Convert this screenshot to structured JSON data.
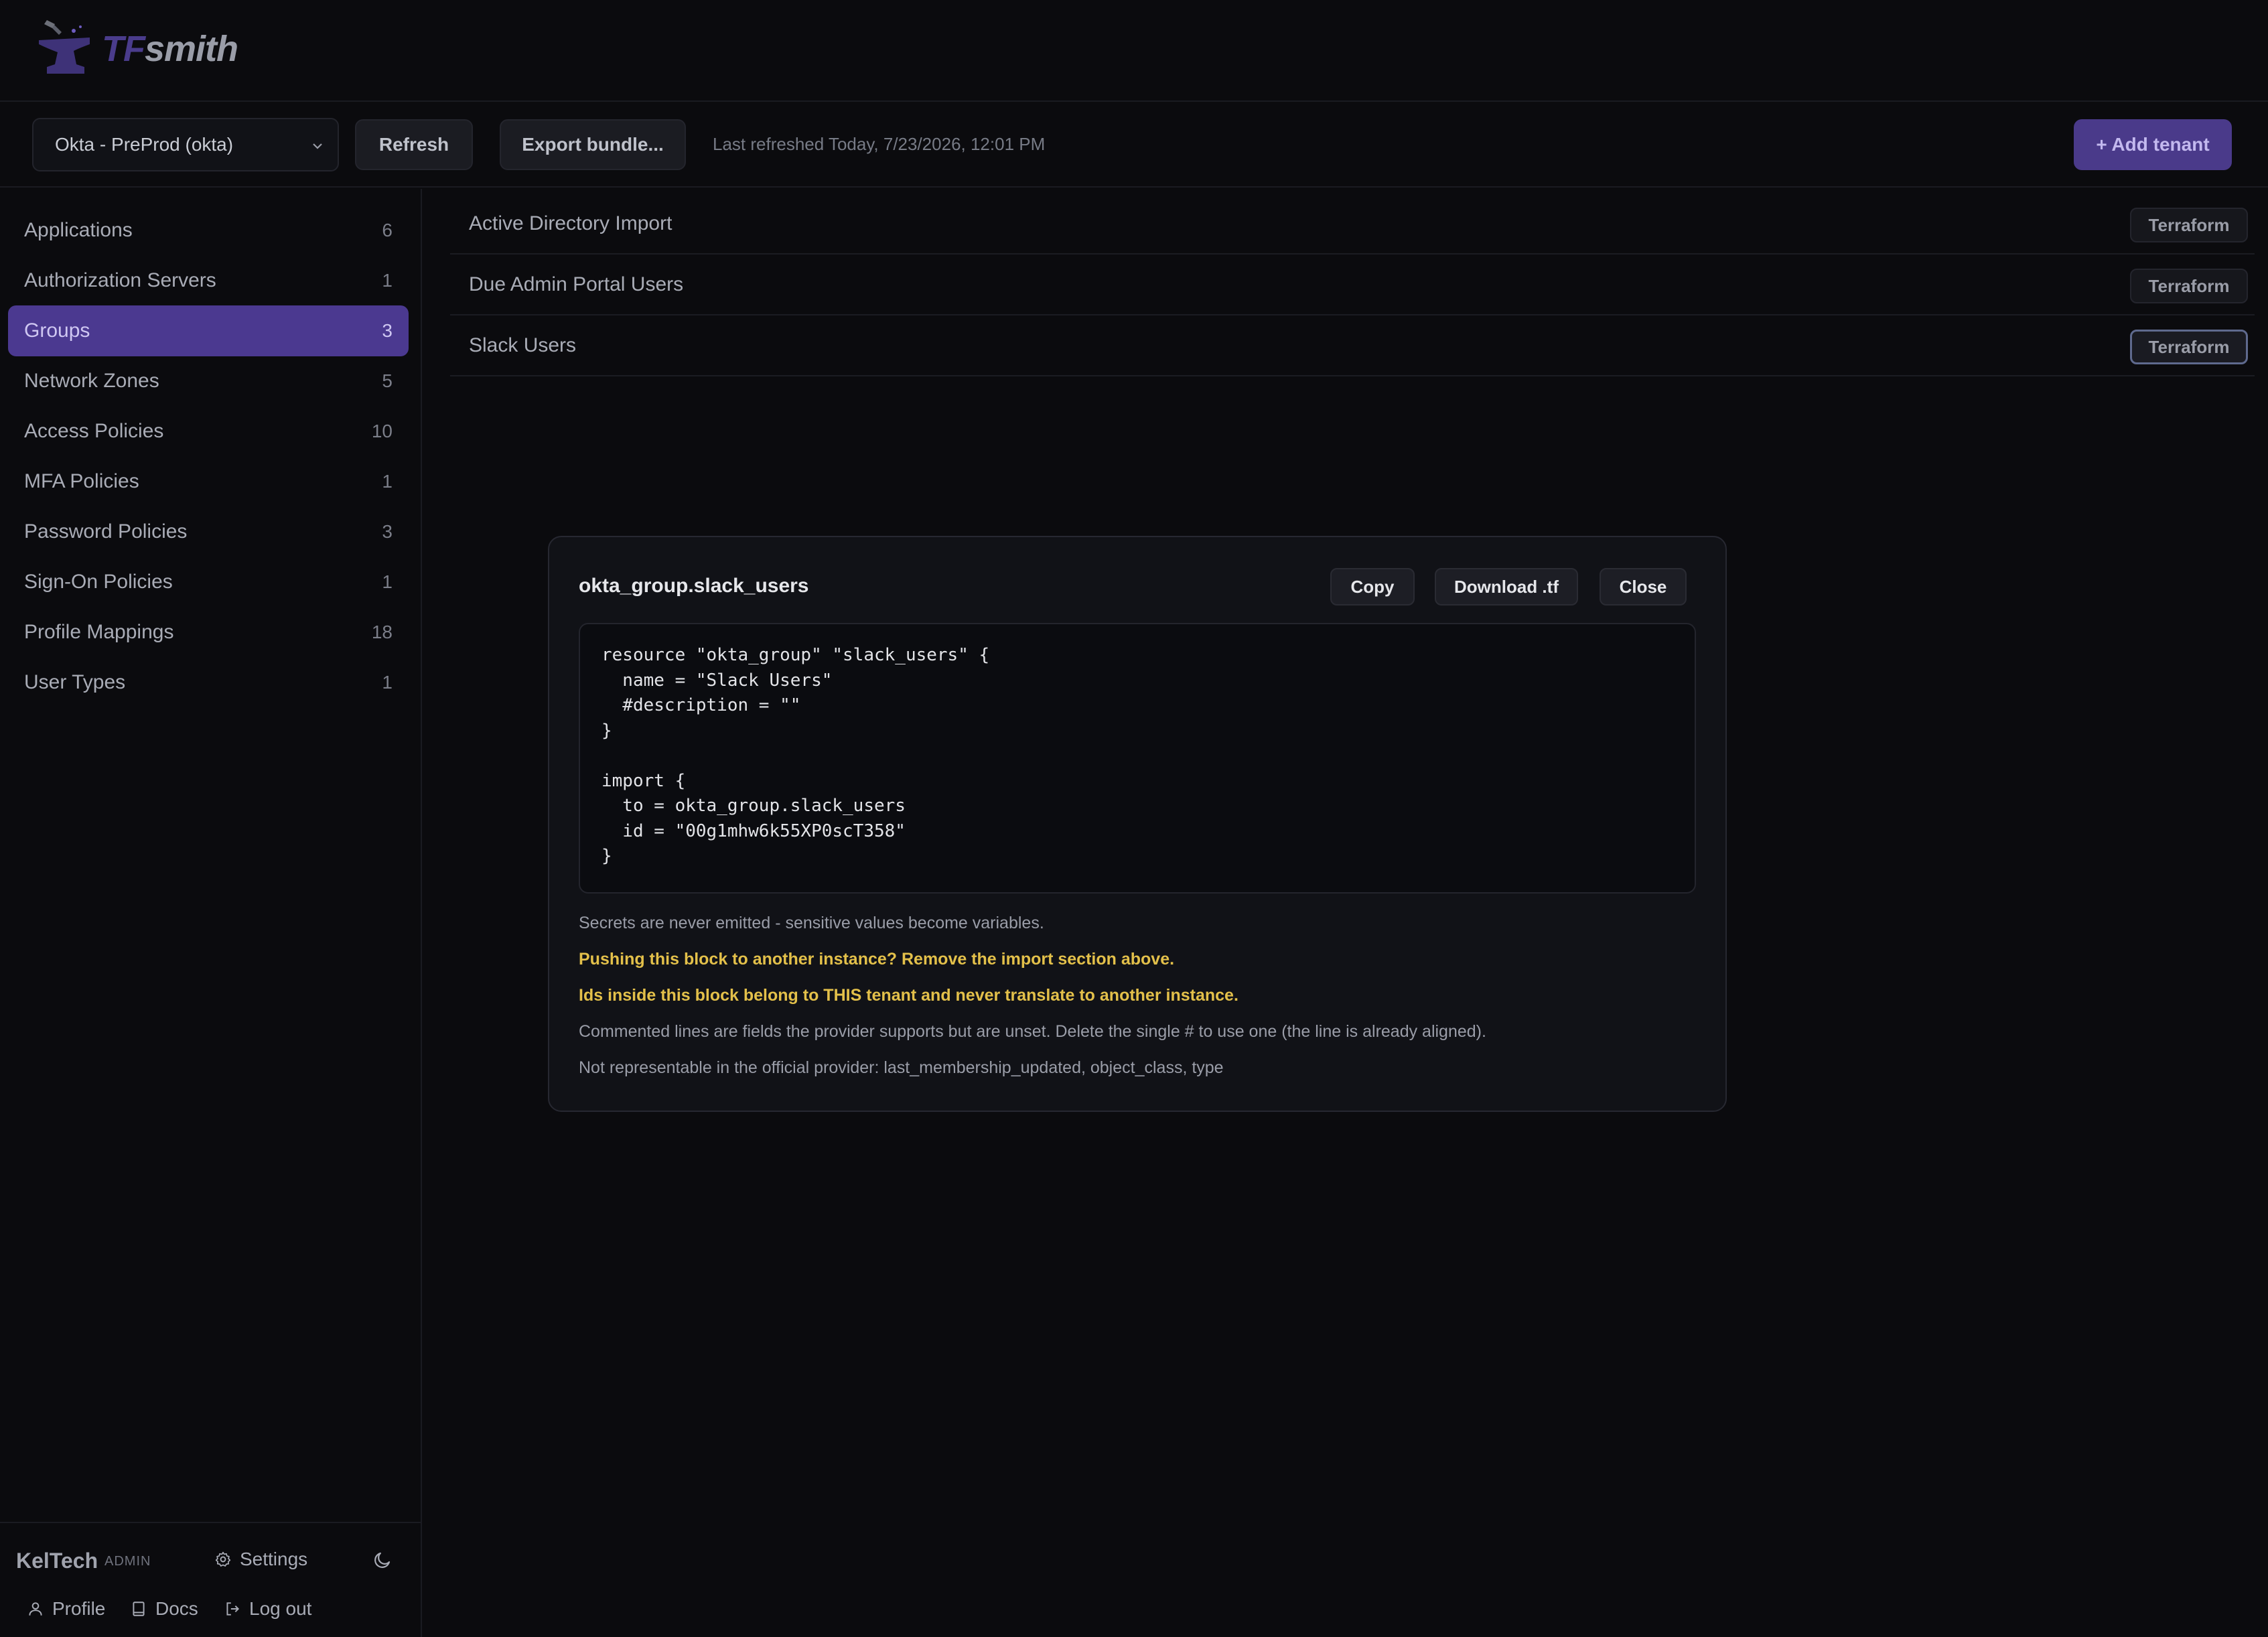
{
  "app": {
    "logo_tf": "TF",
    "logo_smith": "smith"
  },
  "toolbar": {
    "tenant_selected": "Okta - PreProd (okta)",
    "refresh_label": "Refresh",
    "export_label": "Export bundle...",
    "last_refreshed": "Last refreshed Today, 7/23/2026, 12:01 PM",
    "add_tenant_label": "+ Add tenant"
  },
  "sidebar": {
    "items": [
      {
        "label": "Applications",
        "count": "6"
      },
      {
        "label": "Authorization Servers",
        "count": "1"
      },
      {
        "label": "Groups",
        "count": "3"
      },
      {
        "label": "Network Zones",
        "count": "5"
      },
      {
        "label": "Access Policies",
        "count": "10"
      },
      {
        "label": "MFA Policies",
        "count": "1"
      },
      {
        "label": "Password Policies",
        "count": "3"
      },
      {
        "label": "Sign-On Policies",
        "count": "1"
      },
      {
        "label": "Profile Mappings",
        "count": "18"
      },
      {
        "label": "User Types",
        "count": "1"
      }
    ],
    "active_index": 2,
    "footer": {
      "org": "KelTech",
      "role": "ADMIN",
      "settings": "Settings",
      "profile": "Profile",
      "docs": "Docs",
      "logout": "Log out"
    }
  },
  "main": {
    "rows": [
      {
        "name": "Active Directory Import",
        "action": "Terraform"
      },
      {
        "name": "Due Admin Portal Users",
        "action": "Terraform"
      },
      {
        "name": "Slack Users",
        "action": "Terraform"
      }
    ]
  },
  "modal": {
    "title": "okta_group.slack_users",
    "copy_label": "Copy",
    "download_label": "Download .tf",
    "close_label": "Close",
    "code": "resource \"okta_group\" \"slack_users\" {\n  name = \"Slack Users\"\n  #description = \"\"\n}\n\nimport {\n  to = okta_group.slack_users\n  id = \"00g1mhw6k55XP0scT358\"\n}",
    "notes": {
      "secrets": "Secrets are never emitted - sensitive values become variables.",
      "warn_import": "Pushing this block to another instance? Remove the import section above.",
      "warn_ids": "Ids inside this block belong to THIS tenant and never translate to another instance.",
      "commented": "Commented lines are fields the provider supports but are unset. Delete the single # to use one (the line is already aligned).",
      "unrepresentable": "Not representable in the official provider: last_membership_updated, object_class, type"
    }
  },
  "colors": {
    "accent": "#4b3990",
    "warning": "#e3c04a",
    "background": "#0b0b0e"
  }
}
